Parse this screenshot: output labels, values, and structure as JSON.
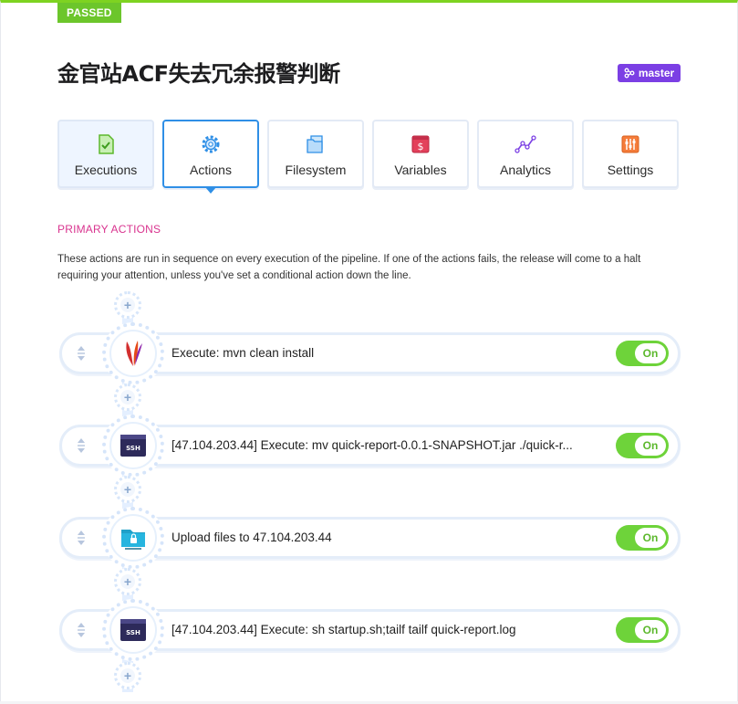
{
  "status": "PASSED",
  "title": "金官站ACF失去冗余报警判断",
  "branch": {
    "label": "master",
    "icon": "branch-icon",
    "color": "#7b3fe4"
  },
  "tabs": [
    {
      "label": "Executions",
      "icon": "executions-icon"
    },
    {
      "label": "Actions",
      "icon": "gear-icon",
      "active": true
    },
    {
      "label": "Filesystem",
      "icon": "filesystem-icon"
    },
    {
      "label": "Variables",
      "icon": "variables-icon"
    },
    {
      "label": "Analytics",
      "icon": "analytics-icon"
    },
    {
      "label": "Settings",
      "icon": "settings-icon"
    }
  ],
  "section": {
    "title": "PRIMARY ACTIONS",
    "description": "These actions are run in sequence on every execution of the pipeline. If one of the actions fails, the release will come to a halt requiring your attention, unless you've set a conditional action down the line."
  },
  "actions": [
    {
      "label": "Execute: mvn clean install",
      "icon": "maven-feather-icon",
      "toggle": "On"
    },
    {
      "label": "[47.104.203.44] Execute: mv quick-report-0.0.1-SNAPSHOT.jar ./quick-r...",
      "icon": "ssh-icon",
      "toggle": "On"
    },
    {
      "label": "Upload files to 47.104.203.44",
      "icon": "sftp-folder-icon",
      "toggle": "On"
    },
    {
      "label": "[47.104.203.44] Execute: sh startup.sh;tailf tailf quick-report.log",
      "icon": "ssh-icon",
      "toggle": "On"
    }
  ],
  "colors": {
    "passed": "#6cc62b",
    "accent": "#2f8fe6",
    "section": "#d9348f",
    "toggle": "#6ed33a"
  }
}
